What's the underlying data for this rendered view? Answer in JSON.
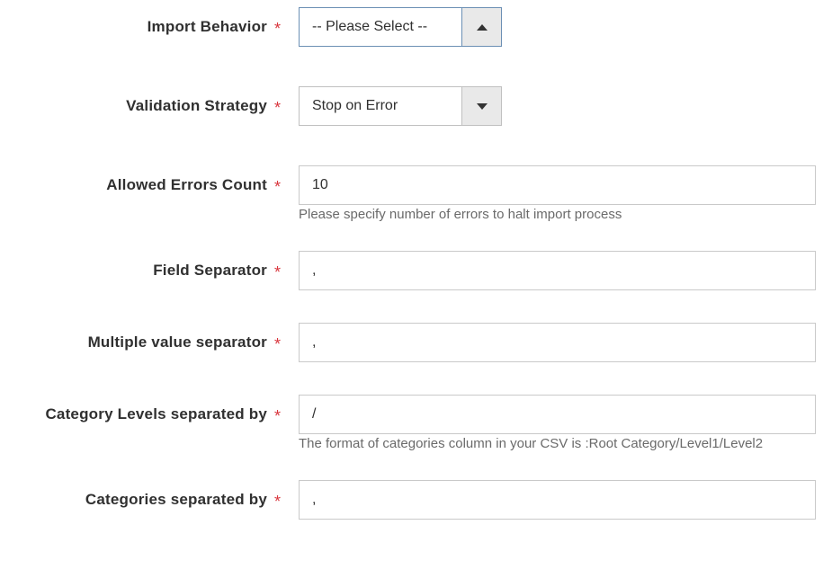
{
  "fields": {
    "importBehavior": {
      "label": "Import Behavior",
      "value": "-- Please Select --"
    },
    "validationStrategy": {
      "label": "Validation Strategy",
      "value": "Stop on Error"
    },
    "allowedErrorsCount": {
      "label": "Allowed Errors Count",
      "value": "10",
      "note": "Please specify number of errors to halt import process"
    },
    "fieldSeparator": {
      "label": "Field Separator",
      "value": ","
    },
    "multipleValueSeparator": {
      "label": "Multiple value separator",
      "value": ","
    },
    "categoryLevelsSeparatedBy": {
      "label": "Category Levels separated by",
      "value": "/",
      "note": "The format of categories column in your CSV is :Root Category/Level1/Level2"
    },
    "categoriesSeparatedBy": {
      "label": "Categories separated by",
      "value": ","
    }
  },
  "requiredMark": "*"
}
